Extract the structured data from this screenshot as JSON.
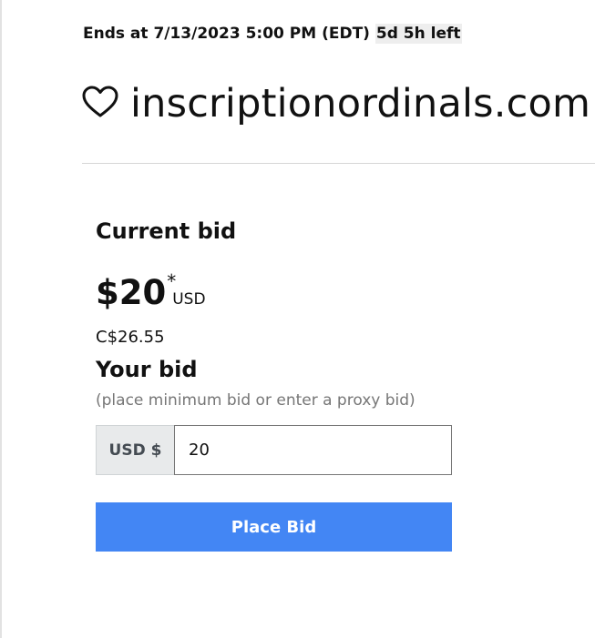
{
  "auction": {
    "ends_prefix": "Ends at 7/13/2023 5:00 PM (EDT)",
    "time_left": "5d 5h left"
  },
  "listing": {
    "domain": "inscriptionordinals.com",
    "favorite_icon": "heart-icon"
  },
  "current_bid": {
    "label": "Current bid",
    "amount": "$20",
    "asterisk": "*",
    "currency": "USD",
    "converted": "C$26.55"
  },
  "your_bid": {
    "label": "Your bid",
    "hint": "(place minimum bid or enter a proxy bid)",
    "currency_addon": "USD $",
    "value": "20"
  },
  "actions": {
    "place_bid_label": "Place Bid"
  },
  "colors": {
    "button_bg": "#4386f4",
    "addon_bg": "#e8eaeb",
    "time_left_bg": "#eeeeee"
  }
}
